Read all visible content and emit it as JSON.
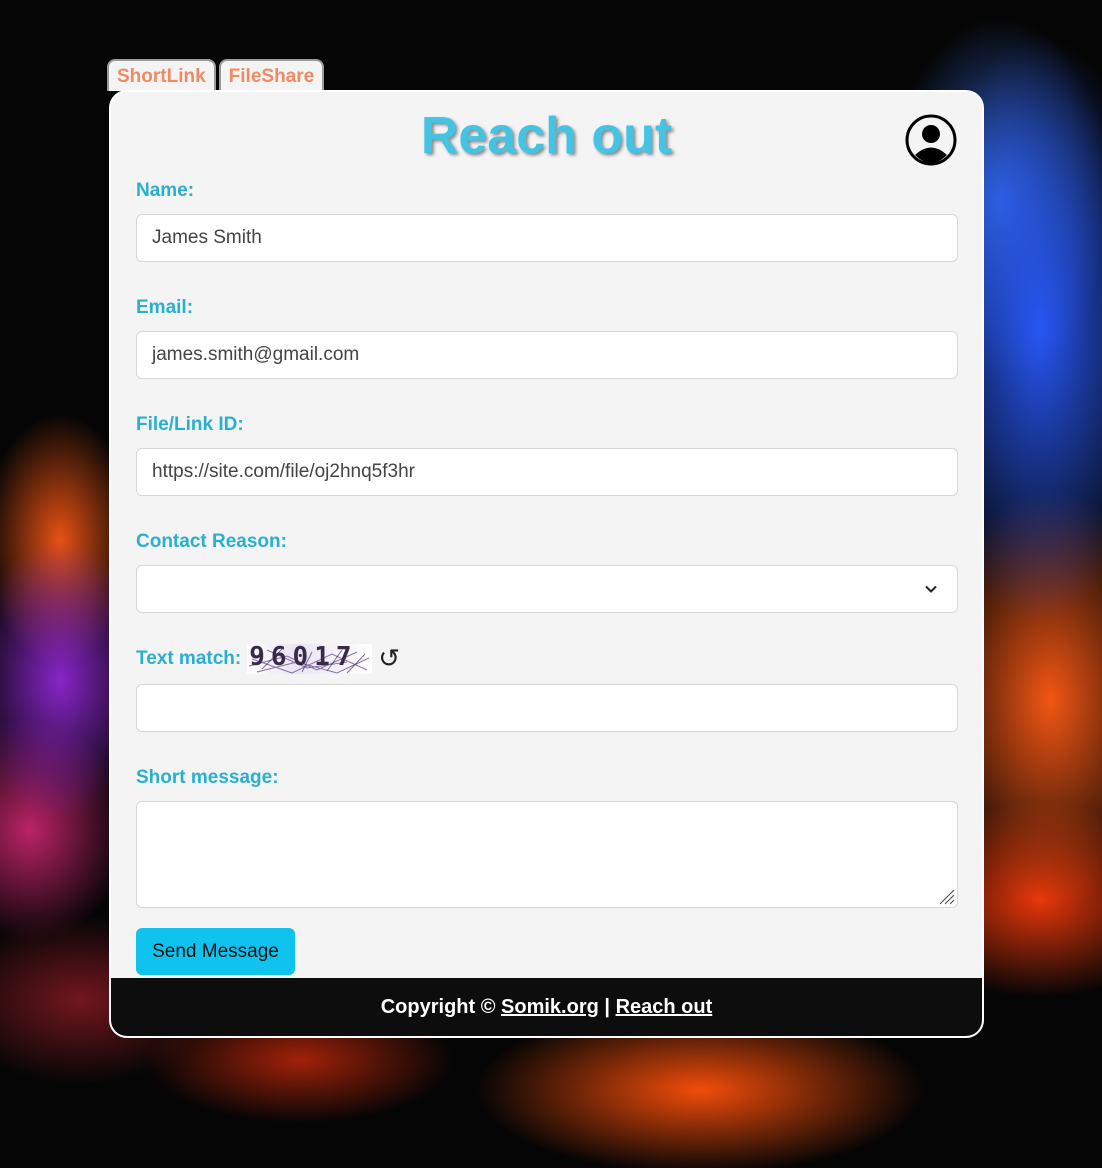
{
  "tabs": [
    {
      "label": "ShortLink"
    },
    {
      "label": "FileShare"
    }
  ],
  "header": {
    "title": "Reach out",
    "profile_icon": "user-circle-icon"
  },
  "form": {
    "name_label": "Name:",
    "name_value": "James Smith",
    "email_label": "Email:",
    "email_value": "james.smith@gmail.com",
    "link_label": "File/Link ID:",
    "link_value": "https://site.com/file/oj2hnq5f3hr",
    "reason_label": "Contact Reason:",
    "reason_value": "",
    "captcha_label": "Text match:",
    "captcha_text": "96017",
    "captcha_refresh": "↺",
    "captcha_value": "",
    "message_label": "Short message:",
    "message_value": "",
    "send_label": "Send Message"
  },
  "footer": {
    "copyright": "Copyright ©",
    "site_link": "Somik.org",
    "separator": "|",
    "reach_link": "Reach out"
  },
  "colors": {
    "accent": "#2ab0cf",
    "title": "#44c3e4",
    "tab_text": "#f08a63",
    "button": "#10c3ee",
    "footer_bg": "#0d0d0d"
  }
}
